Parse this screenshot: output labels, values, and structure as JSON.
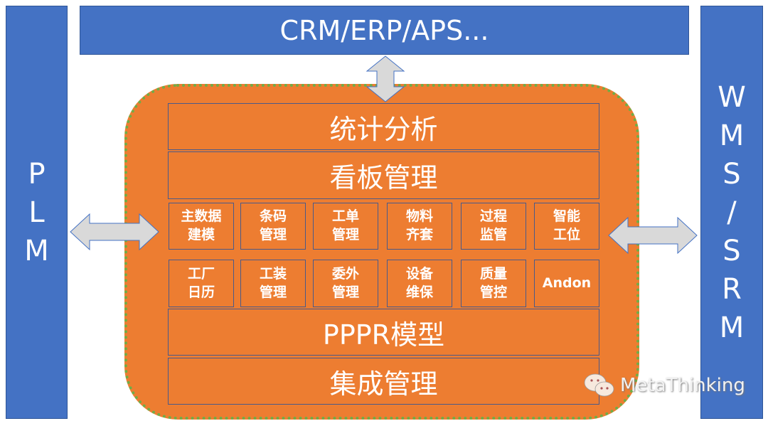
{
  "top_system": "CRM/ERP/APS...",
  "left_system": [
    "P",
    "L",
    "M"
  ],
  "right_system": [
    "W",
    "M",
    "S",
    "/",
    "S",
    "R",
    "M"
  ],
  "core": {
    "layers_top": [
      "统计分析",
      "看板管理"
    ],
    "modules_row1": [
      "主数据\n建模",
      "条码\n管理",
      "工单\n管理",
      "物料\n齐套",
      "过程\n监管",
      "智能\n工位"
    ],
    "modules_row2": [
      "工厂\n日历",
      "工装\n管理",
      "委外\n管理",
      "设备\n维保",
      "质量\n管控",
      "Andon"
    ],
    "layers_bottom": [
      "PPPR模型",
      "集成管理"
    ]
  },
  "watermark": "MetaThinking",
  "colors": {
    "system": "#4472c4",
    "core": "#ed7d31",
    "border": "#70ad47",
    "arrow": "#d9d9d9"
  }
}
